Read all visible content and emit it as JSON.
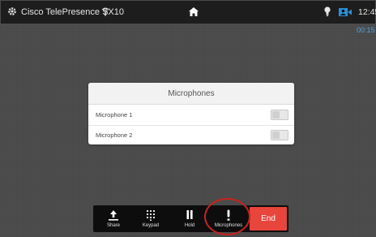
{
  "status_bar": {
    "device_name": "Cisco TelePresence SX10",
    "clock": "12:45",
    "call_timer": "00:15"
  },
  "dialog": {
    "title": "Microphones",
    "items": [
      {
        "label": "Microphone 1",
        "enabled": false
      },
      {
        "label": "Microphone 2",
        "enabled": false
      }
    ]
  },
  "toolbar": {
    "share_label": "Share",
    "keypad_label": "Keypad",
    "hold_label": "Hold",
    "microphones_label": "Microphones",
    "end_label": "End"
  },
  "colors": {
    "end_button": "#e8453c",
    "call_timer": "#4aa3e6",
    "highlight": "#c8231c",
    "selfview_icon": "#2a8fd9"
  },
  "icons": [
    "gear-icon",
    "signal-icon",
    "home-icon",
    "lightbulb-icon",
    "selfview-icon",
    "share-icon",
    "keypad-icon",
    "pause-icon",
    "microphone-icon"
  ]
}
